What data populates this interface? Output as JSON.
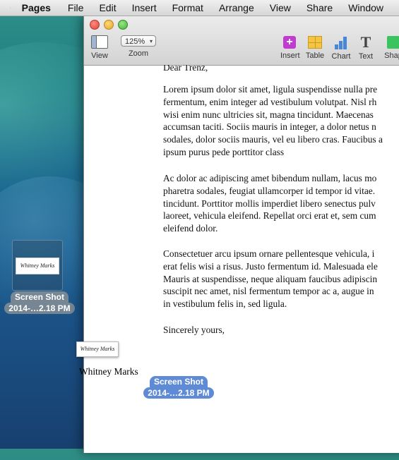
{
  "menubar": {
    "app_name": "Pages",
    "items": [
      "File",
      "Edit",
      "Insert",
      "Format",
      "Arrange",
      "View",
      "Share",
      "Window"
    ]
  },
  "toolbar": {
    "view_label": "View",
    "zoom_value": "125%",
    "zoom_label": "Zoom",
    "insert_label": "Insert",
    "table_label": "Table",
    "chart_label": "Chart",
    "text_label": "Text",
    "shape_label": "Shap"
  },
  "document": {
    "greeting": "Dear Trenz,",
    "paragraphs": [
      [
        "Lorem ipsum dolor sit amet, ligula suspendisse nulla pre",
        "fermentum, enim integer ad vestibulum volutpat. Nisl rh",
        "wisi enim nunc ultricies sit, magna tincidunt. Maecenas",
        "accumsan taciti. Sociis mauris in integer, a dolor netus n",
        "sodales, dolor sociis mauris, vel eu libero cras. Faucibus a",
        "ipsum purus pede porttitor class"
      ],
      [
        "Ac dolor ac adipiscing amet bibendum nullam, lacus mo",
        "pharetra sodales, feugiat ullamcorper id tempor id vitae.",
        "tincidunt. Porttitor mollis imperdiet libero senectus pulv",
        "laoreet, vehicula eleifend. Repellat orci erat et, sem cum",
        "eleifend dolor."
      ],
      [
        "Consectetuer arcu ipsum ornare pellentesque vehicula, i",
        "erat felis wisi a risus. Justo fermentum id. Malesuada ele",
        "Mauris at suspendisse, neque aliquam faucibus adipiscin",
        "suscipit nec amet, nisl fermentum tempor ac a, augue in",
        "in vestibulum felis in, sed ligula."
      ]
    ],
    "closing": "Sincerely yours,",
    "signature_image_text": "Whitney Marks",
    "signature_name": "Whitney Marks"
  },
  "drag_item": {
    "line1": "Screen Shot",
    "line2": "2014-…2.18 PM"
  },
  "desktop_file": {
    "thumb_text": "Whitney Marks",
    "line1": "Screen Shot",
    "line2": "2014-…2.18 PM"
  }
}
